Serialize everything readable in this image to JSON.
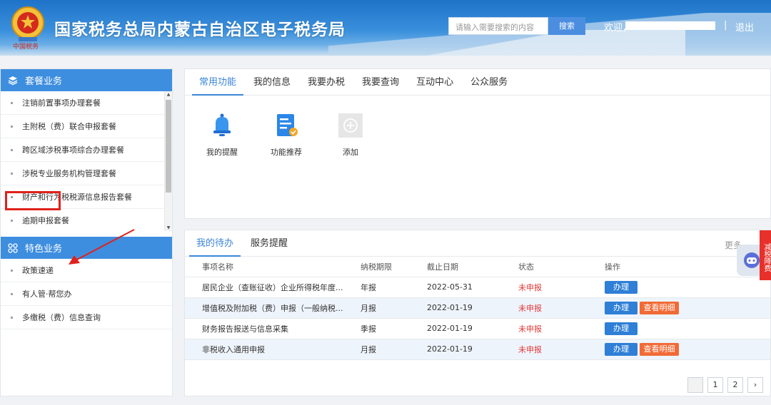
{
  "header": {
    "title": "国家税务总局内蒙古自治区电子税务局",
    "emblem_caption": "中国税务",
    "search_placeholder": "请输入需要搜索的内容",
    "search_button": "搜索",
    "welcome": "欢迎，",
    "divider": "|",
    "logout": "退出"
  },
  "sidebar": {
    "package_title": "套餐业务",
    "package_items": [
      "注销前置事项办理套餐",
      "主附税（费）联合申报套餐",
      "跨区域涉税事项综合办理套餐",
      "涉税专业服务机构管理套餐",
      "财产和行为税税源信息报告套餐",
      "逾期申报套餐"
    ],
    "special_title": "特色业务",
    "special_items": [
      "政策速递",
      "有人管·帮您办",
      "多缴税（费）信息查询"
    ]
  },
  "top_panel": {
    "tabs": [
      "常用功能",
      "我的信息",
      "我要办税",
      "我要查询",
      "互动中心",
      "公众服务"
    ],
    "functions": [
      "我的提醒",
      "功能推荐",
      "添加"
    ]
  },
  "bottom_panel": {
    "tabs": [
      "我的待办",
      "服务提醒"
    ],
    "more": "更多",
    "columns": [
      "事项名称",
      "纳税期限",
      "截止日期",
      "状态",
      "操作"
    ],
    "rows": [
      {
        "name": "居民企业（查账征收）企业所得税年度...",
        "period": "年报",
        "deadline": "2022-05-31",
        "status": "未申报",
        "action": "办理",
        "detail": ""
      },
      {
        "name": "增值税及附加税（费）申报（一般纳税...",
        "period": "月报",
        "deadline": "2022-01-19",
        "status": "未申报",
        "action": "办理",
        "detail": "查看明细"
      },
      {
        "name": "财务报告报送与信息采集",
        "period": "季报",
        "deadline": "2022-01-19",
        "status": "未申报",
        "action": "办理",
        "detail": ""
      },
      {
        "name": "非税收入通用申报",
        "period": "月报",
        "deadline": "2022-01-19",
        "status": "未申报",
        "action": "办理",
        "detail": "查看明细"
      }
    ],
    "pages": [
      "1",
      "2"
    ],
    "next": "›"
  },
  "float_tag": "减税降费",
  "colors": {
    "primary": "#3e8ee0",
    "danger": "#e03a3a",
    "detail": "#f26a36",
    "highlight": "#e0211b"
  }
}
